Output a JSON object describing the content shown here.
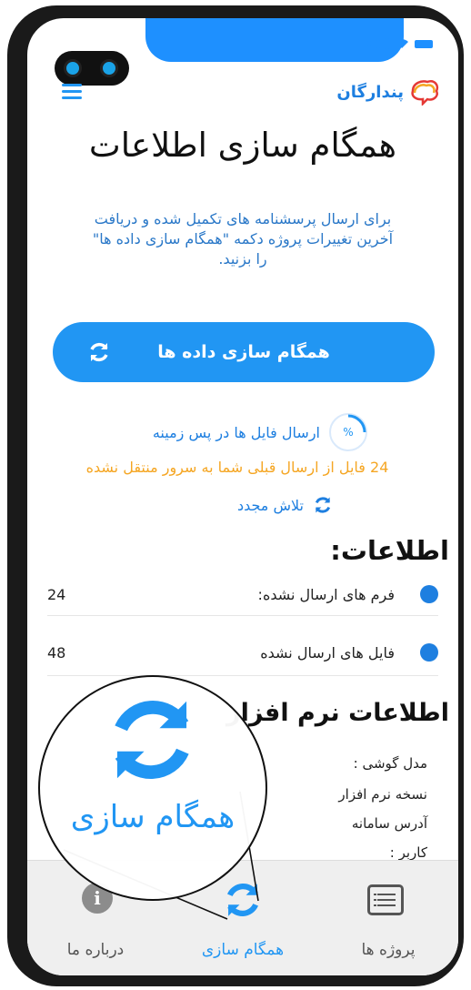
{
  "header": {
    "logo_text": "پندارگان"
  },
  "page": {
    "title": "همگام سازی اطلاعات",
    "description_line1": "برای ارسال پرسشنامه های تکمیل شده و دریافت",
    "description_line2": "آخرین تغییرات پروژه دکمه \"همگام سازی داده ها\"",
    "description_line3": "را بزنید."
  },
  "sync_button": {
    "label": "همگام سازی داده ها"
  },
  "background_upload": {
    "label": "ارسال فایل ها در پس زمینه",
    "progress_symbol": "%"
  },
  "warning": {
    "text": "24 فایل از ارسال قبلی شما به سرور منتقل نشده"
  },
  "retry": {
    "label": "تلاش مجدد"
  },
  "info": {
    "title": "اطلاعات:",
    "rows": [
      {
        "label": "فرم های ارسال نشده:",
        "value": "24"
      },
      {
        "label": "فایل های ارسال نشده",
        "value": "48"
      }
    ]
  },
  "software_info": {
    "title": "اطلاعات نرم افزار",
    "items": [
      "مدل گوشی :",
      "نسخه نرم افزار",
      "آدرس سامانه",
      "کاربر :"
    ]
  },
  "magnifier": {
    "label": "همگام سازی"
  },
  "bottom_nav": {
    "items": [
      {
        "label": "درباره ما",
        "icon": "info-icon",
        "active": false
      },
      {
        "label": "همگام سازی",
        "icon": "sync-icon",
        "active": true
      },
      {
        "label": "پروژه ها",
        "icon": "list-icon",
        "active": false
      }
    ]
  },
  "colors": {
    "primary": "#2196f3",
    "link": "#1e7fe0",
    "warning": "#f5a623",
    "nav_bg": "#efefef",
    "inactive": "#555555"
  }
}
